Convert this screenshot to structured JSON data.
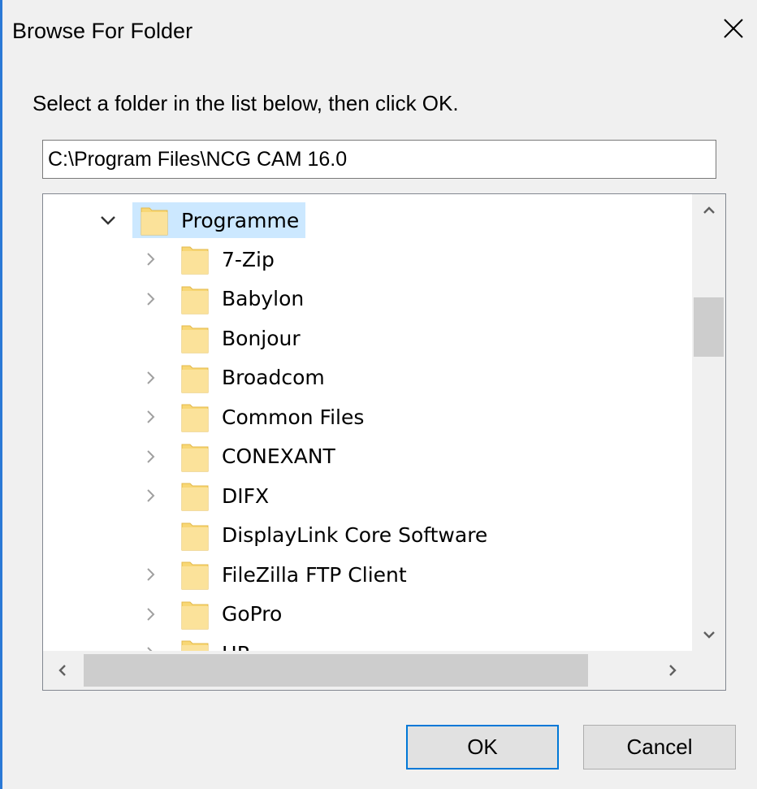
{
  "window": {
    "title": "Browse For Folder"
  },
  "dialog": {
    "instruction": "Select a folder in the list below, then click OK.",
    "path_value": "C:\\Program Files\\NCG CAM 16.0"
  },
  "tree": {
    "root": {
      "label": "Programme",
      "expanded": true,
      "selected": true
    },
    "items": [
      {
        "label": "7-Zip",
        "has_children": true
      },
      {
        "label": "Babylon",
        "has_children": true
      },
      {
        "label": "Bonjour",
        "has_children": false
      },
      {
        "label": "Broadcom",
        "has_children": true
      },
      {
        "label": "Common Files",
        "has_children": true
      },
      {
        "label": "CONEXANT",
        "has_children": true
      },
      {
        "label": "DIFX",
        "has_children": true
      },
      {
        "label": "DisplayLink Core Software",
        "has_children": false
      },
      {
        "label": "FileZilla FTP Client",
        "has_children": true
      },
      {
        "label": "GoPro",
        "has_children": true
      },
      {
        "label": "HP",
        "has_children": true
      }
    ]
  },
  "buttons": {
    "ok": "OK",
    "cancel": "Cancel"
  },
  "colors": {
    "accent": "#0078d7",
    "selection": "#cce8ff",
    "folder": "#f8d775"
  },
  "icons": {
    "close": "close-icon",
    "folder": "folder-icon",
    "expand": "chevron-right-icon",
    "collapse": "chevron-down-icon"
  }
}
